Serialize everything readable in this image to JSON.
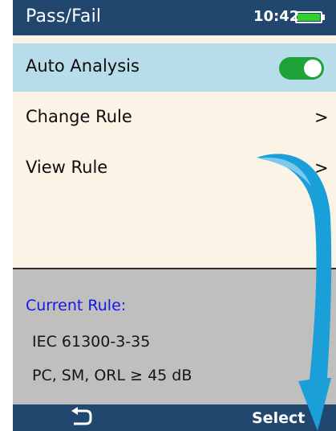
{
  "status_bar": {
    "title": "Pass/Fail",
    "time": "10:42",
    "battery_level": 1.0,
    "battery_color": "#2fd12b"
  },
  "menu": {
    "items": [
      {
        "label": "Auto Analysis",
        "control": "toggle",
        "toggle_on": true,
        "selected": true
      },
      {
        "label": "Change Rule",
        "control": "chevron",
        "chevron": ">"
      },
      {
        "label": "View Rule",
        "control": "chevron",
        "chevron": ">"
      }
    ]
  },
  "current_rule": {
    "header": "Current Rule:",
    "lines": [
      "IEC 61300-3-35",
      "PC, SM, ORL ≥ 45 dB"
    ]
  },
  "softkeys": {
    "back_icon": "return-arrow-icon",
    "select_label": "Select"
  },
  "colors": {
    "header_bar": "#21476f",
    "selected_row": "#b7dcea",
    "toggle_on": "#1fa338",
    "rule_header": "#1418e8",
    "overlay_arrow": "#1a9fd9"
  }
}
